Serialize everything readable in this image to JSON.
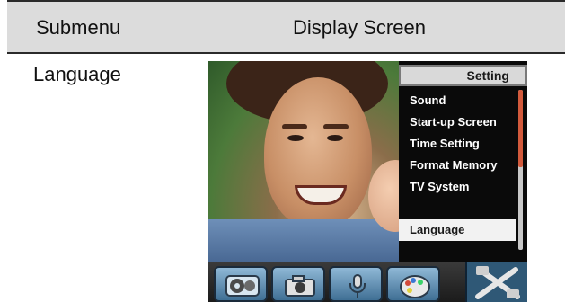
{
  "table": {
    "headers": [
      "Submenu",
      "Display Screen"
    ],
    "rows": [
      {
        "submenu": "Language"
      }
    ]
  },
  "device_screen": {
    "menu_title": "Setting",
    "menu_items": [
      "Sound",
      "Start-up Screen",
      "Time Setting",
      "Format Memory",
      "TV System",
      "Language"
    ],
    "selected_item": "Language",
    "toolbar_icons": [
      "film-reel-icon",
      "camera-icon",
      "microphone-icon",
      "palette-icon",
      "tools-icon"
    ],
    "colors": {
      "menu_background": "#0a0a0a",
      "selected_background": "#f2f2f2",
      "scroll_thumb": "#d25a3c",
      "toolbar_active": "#2f5876"
    }
  }
}
